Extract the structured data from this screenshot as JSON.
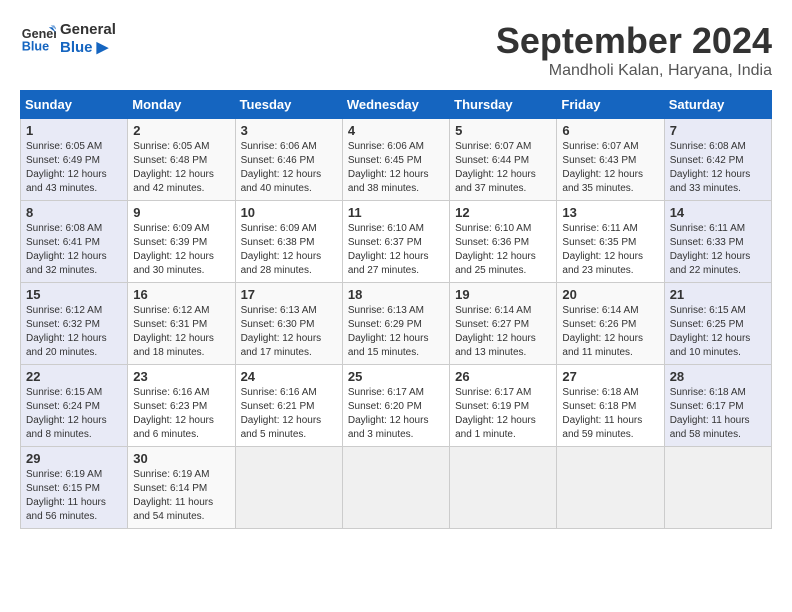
{
  "header": {
    "logo_line1": "General",
    "logo_line2": "Blue",
    "month_title": "September 2024",
    "subtitle": "Mandholi Kalan, Haryana, India"
  },
  "days_of_week": [
    "Sunday",
    "Monday",
    "Tuesday",
    "Wednesday",
    "Thursday",
    "Friday",
    "Saturday"
  ],
  "weeks": [
    [
      {
        "day": "1",
        "sunrise": "6:05 AM",
        "sunset": "6:49 PM",
        "daylight": "12 hours and 43 minutes."
      },
      {
        "day": "2",
        "sunrise": "6:05 AM",
        "sunset": "6:48 PM",
        "daylight": "12 hours and 42 minutes."
      },
      {
        "day": "3",
        "sunrise": "6:06 AM",
        "sunset": "6:46 PM",
        "daylight": "12 hours and 40 minutes."
      },
      {
        "day": "4",
        "sunrise": "6:06 AM",
        "sunset": "6:45 PM",
        "daylight": "12 hours and 38 minutes."
      },
      {
        "day": "5",
        "sunrise": "6:07 AM",
        "sunset": "6:44 PM",
        "daylight": "12 hours and 37 minutes."
      },
      {
        "day": "6",
        "sunrise": "6:07 AM",
        "sunset": "6:43 PM",
        "daylight": "12 hours and 35 minutes."
      },
      {
        "day": "7",
        "sunrise": "6:08 AM",
        "sunset": "6:42 PM",
        "daylight": "12 hours and 33 minutes."
      }
    ],
    [
      {
        "day": "8",
        "sunrise": "6:08 AM",
        "sunset": "6:41 PM",
        "daylight": "12 hours and 32 minutes."
      },
      {
        "day": "9",
        "sunrise": "6:09 AM",
        "sunset": "6:39 PM",
        "daylight": "12 hours and 30 minutes."
      },
      {
        "day": "10",
        "sunrise": "6:09 AM",
        "sunset": "6:38 PM",
        "daylight": "12 hours and 28 minutes."
      },
      {
        "day": "11",
        "sunrise": "6:10 AM",
        "sunset": "6:37 PM",
        "daylight": "12 hours and 27 minutes."
      },
      {
        "day": "12",
        "sunrise": "6:10 AM",
        "sunset": "6:36 PM",
        "daylight": "12 hours and 25 minutes."
      },
      {
        "day": "13",
        "sunrise": "6:11 AM",
        "sunset": "6:35 PM",
        "daylight": "12 hours and 23 minutes."
      },
      {
        "day": "14",
        "sunrise": "6:11 AM",
        "sunset": "6:33 PM",
        "daylight": "12 hours and 22 minutes."
      }
    ],
    [
      {
        "day": "15",
        "sunrise": "6:12 AM",
        "sunset": "6:32 PM",
        "daylight": "12 hours and 20 minutes."
      },
      {
        "day": "16",
        "sunrise": "6:12 AM",
        "sunset": "6:31 PM",
        "daylight": "12 hours and 18 minutes."
      },
      {
        "day": "17",
        "sunrise": "6:13 AM",
        "sunset": "6:30 PM",
        "daylight": "12 hours and 17 minutes."
      },
      {
        "day": "18",
        "sunrise": "6:13 AM",
        "sunset": "6:29 PM",
        "daylight": "12 hours and 15 minutes."
      },
      {
        "day": "19",
        "sunrise": "6:14 AM",
        "sunset": "6:27 PM",
        "daylight": "12 hours and 13 minutes."
      },
      {
        "day": "20",
        "sunrise": "6:14 AM",
        "sunset": "6:26 PM",
        "daylight": "12 hours and 11 minutes."
      },
      {
        "day": "21",
        "sunrise": "6:15 AM",
        "sunset": "6:25 PM",
        "daylight": "12 hours and 10 minutes."
      }
    ],
    [
      {
        "day": "22",
        "sunrise": "6:15 AM",
        "sunset": "6:24 PM",
        "daylight": "12 hours and 8 minutes."
      },
      {
        "day": "23",
        "sunrise": "6:16 AM",
        "sunset": "6:23 PM",
        "daylight": "12 hours and 6 minutes."
      },
      {
        "day": "24",
        "sunrise": "6:16 AM",
        "sunset": "6:21 PM",
        "daylight": "12 hours and 5 minutes."
      },
      {
        "day": "25",
        "sunrise": "6:17 AM",
        "sunset": "6:20 PM",
        "daylight": "12 hours and 3 minutes."
      },
      {
        "day": "26",
        "sunrise": "6:17 AM",
        "sunset": "6:19 PM",
        "daylight": "12 hours and 1 minute."
      },
      {
        "day": "27",
        "sunrise": "6:18 AM",
        "sunset": "6:18 PM",
        "daylight": "11 hours and 59 minutes."
      },
      {
        "day": "28",
        "sunrise": "6:18 AM",
        "sunset": "6:17 PM",
        "daylight": "11 hours and 58 minutes."
      }
    ],
    [
      {
        "day": "29",
        "sunrise": "6:19 AM",
        "sunset": "6:15 PM",
        "daylight": "11 hours and 56 minutes."
      },
      {
        "day": "30",
        "sunrise": "6:19 AM",
        "sunset": "6:14 PM",
        "daylight": "11 hours and 54 minutes."
      },
      null,
      null,
      null,
      null,
      null
    ]
  ]
}
